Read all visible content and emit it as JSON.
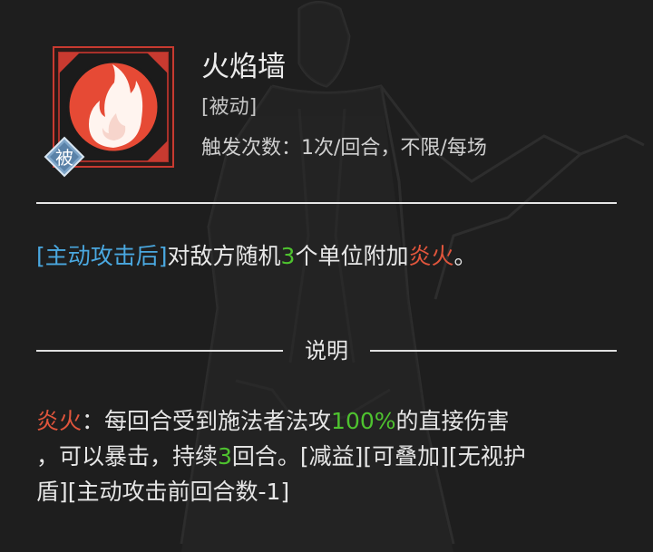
{
  "skill": {
    "name": "火焰墙",
    "tag": "[被动]",
    "badge": "被",
    "trigger_label": "触发次数：",
    "trigger_value": "1次/回合，不限/每场"
  },
  "effect": {
    "condition": "[主动攻击后]",
    "text_a": "对敌方随机",
    "count": "3",
    "text_b": "个单位附加",
    "status": "炎火",
    "end": "。"
  },
  "section": {
    "label": "说明"
  },
  "desc": {
    "term": "炎火",
    "colon": "：",
    "text_a": "每回合受到施法者法攻",
    "percent": "100%",
    "text_b": "的直接伤害",
    "text_c": "，可以暴击，持续",
    "turns": "3",
    "text_d": "回合。[减益][可叠加][无视护",
    "text_e": "盾][主动攻击前回合数-1]"
  },
  "colors": {
    "condition": "#4aa8e0",
    "number": "#4ec22f",
    "status": "#e0553c",
    "icon_frame": "#c83a30",
    "icon_fill": "#e64a35"
  }
}
